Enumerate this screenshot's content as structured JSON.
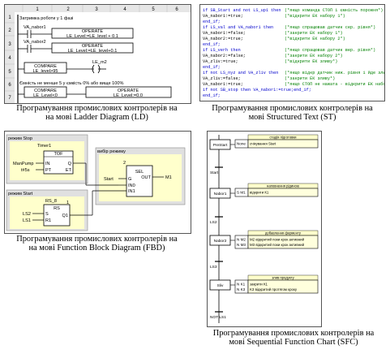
{
  "ld": {
    "col_headers": [
      "1",
      "2",
      "3",
      "4",
      "5",
      "6"
    ],
    "row_numbers": [
      "1",
      "2",
      "3",
      "4",
      "5",
      "6",
      "7"
    ],
    "row1_label": "Затримка роботи у 1 фазі",
    "contact1": "VA_nabor1",
    "block1_title": "OPERATE",
    "block1_expr": "LE_Level:=LE_level + 0.1",
    "contact2": "VA_nabor2",
    "block2_title": "OPERATE",
    "block2_expr": "LE_Level:=LE_level+0.1",
    "compare1_title": "COMPARE",
    "compare1_expr": "LE_level>95",
    "coil1": "LE_m2",
    "row6_label": "Ємність не менше 5 у ємкість 0% або вище 100%",
    "compare2_title": "COMPARE",
    "compare2_expr": "LE_Level<0",
    "block3_title": "OPERATE",
    "block3_expr": "LE_Level:=0.0",
    "caption_line1": "Програмування промислових контролерів на",
    "caption_line2": "на мові Ladder Diagram (LD)"
  },
  "st": {
    "lines": [
      {
        "code": "if SB_Start and not LS_up1 then",
        "comment": "(*якщо команда СТОП і ємність порожня*)"
      },
      {
        "code": "    VA_nabor1:=true;",
        "comment": "(*відкрити ЕК набору 1*)"
      },
      {
        "code": "end_if;",
        "comment": ""
      },
      {
        "code": "if LS_val and VA_nabor1 then",
        "comment": "(*якщо спрацював датчик сер. рівня*)"
      },
      {
        "code": "    VA_nabor1:=false;",
        "comment": "(*закрити ЕК набору 1*)"
      },
      {
        "code": "    VA_nabor2:=true;",
        "comment": "(*відкрити ЕК набору 2*)"
      },
      {
        "code": "end_if;",
        "comment": ""
      },
      {
        "code": "if LS_verh then",
        "comment": "(*якщо спрацював датчик вер. рівня*)"
      },
      {
        "code": "    VA_nabor2:=false;",
        "comment": "(*закрити ЕК набору 2*)"
      },
      {
        "code": "    VA_zliv:=true;",
        "comment": "(*відкрити ЕК зливу*)"
      },
      {
        "code": "end_if;",
        "comment": ""
      },
      {
        "code": "if not LS_nyz and VA_zliv then",
        "comment": "(*якщо відкр датчик ниж. рівня і йде злив*)"
      },
      {
        "code": "    VA_zliv:=false;",
        "comment": "(*закрити ЕК зливу*)"
      },
      {
        "code": "    VA_nabor1:=true;",
        "comment": "(*якщо СТОП не нажата - відкрити ЕК набору 1*)"
      },
      {
        "code": "    if not SB_stop then VA_nabor1:=true;end_if;",
        "comment": ""
      },
      {
        "code": "end_if;",
        "comment": ""
      }
    ],
    "caption_line1": "Програмування промислових контролерів на",
    "caption_line2": "мові Structured Text (ST)"
  },
  "fbd": {
    "stop_label": "режим Stop",
    "timer_instance": "Timer1",
    "timer_type": "TOF",
    "timer_in": "IN",
    "timer_pt": "PT",
    "timer_q": "Q",
    "timer_et": "ET",
    "input_pump": "ManPump",
    "input_time": "t#5s",
    "select_label": "вибір режиму",
    "sel_num": "2",
    "sel_type": "SEL",
    "sel_g": "G",
    "sel_in0": "IN0",
    "sel_in1": "IN1",
    "sel_out": "OUT",
    "sel_start": "Start",
    "output_m": "M1",
    "start_label": "режим Start",
    "rs_instance": "RS_8",
    "rs_type": "RS",
    "rs_s": "S",
    "rs_r1": "R1",
    "rs_q1": "Q1",
    "input_ls2": "LS2",
    "input_ls1": "LS1",
    "rs_num": "1",
    "caption_line1": "Програмування промислових контролерів на",
    "caption_line2": "на мові Function Block Diagram (FBD)"
  },
  "sfc": {
    "steps": [
      {
        "name": "PreStart",
        "qual": "None",
        "title": "стадія підготовки",
        "action": "очікування Start"
      },
      {
        "name": "Nabor1",
        "qual": "S M1",
        "title": "наповнення рідиною",
        "action": "відкрити К1"
      },
      {
        "name": "Nabor2",
        "qual": "N M2",
        "qual2": "N M3",
        "title": "добавлення ферменту",
        "action": "M2 відкритий поки крок активний",
        "action2": "M3 відкритий поки крок активний"
      },
      {
        "name": "Sliv",
        "qual": "N K1",
        "qual2": "N K3",
        "title": "злив продукту",
        "action": "закрити К1",
        "action2": "K3 відкритий протягом кроку"
      }
    ],
    "transitions": [
      "Start",
      "LS2",
      "LS3",
      "NOT LS1"
    ],
    "caption_line1": "Програмування промислових контролерів на",
    "caption_line2": "мові Sequential Function Chart (SFC)"
  },
  "colors": {
    "keyword": "#0000cc",
    "comment": "#008000",
    "ld_header": "#e6e6e6",
    "sfc_title": "#ffffcc",
    "sfc_action": "#ffffdd",
    "fbd_group": "#e0e0e0",
    "fbd_bg": "#ffffcc"
  }
}
